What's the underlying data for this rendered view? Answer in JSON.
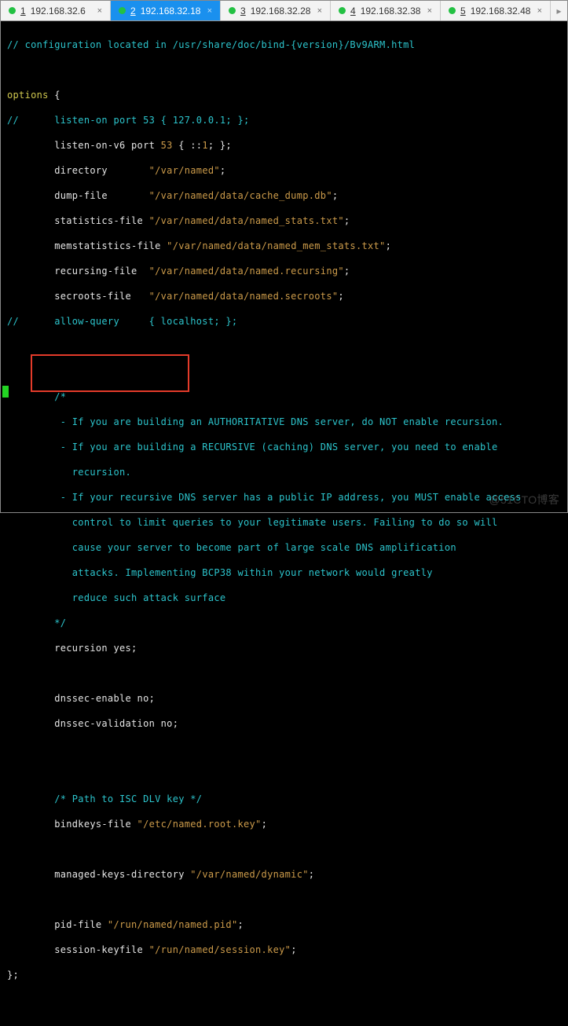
{
  "tabs": [
    {
      "index": "1",
      "label": "192.168.32.6",
      "active": false
    },
    {
      "index": "2",
      "label": "192.168.32.18",
      "active": true
    },
    {
      "index": "3",
      "label": "192.168.32.28",
      "active": false
    },
    {
      "index": "4",
      "label": "192.168.32.38",
      "active": false
    },
    {
      "index": "5",
      "label": "192.168.32.48",
      "active": false
    }
  ],
  "code": {
    "l1_a": "// configuration located in /usr/share/doc/bind-{version}/Bv9ARM.html",
    "l2_a": "options ",
    "l2_b": "{",
    "l3_a": "//      listen-on port 53 { 127.0.0.1; };",
    "l4_a": "        listen-on-v6 port ",
    "l4_b": "53",
    "l4_c": " { ::",
    "l4_d": "1",
    "l4_e": "; };",
    "l5_a": "        directory       ",
    "l5_b": "\"/var/named\"",
    "l5_c": ";",
    "l6_a": "        dump-file       ",
    "l6_b": "\"/var/named/data/cache_dump.db\"",
    "l6_c": ";",
    "l7_a": "        statistics-file ",
    "l7_b": "\"/var/named/data/named_stats.txt\"",
    "l7_c": ";",
    "l8_a": "        memstatistics-file ",
    "l8_b": "\"/var/named/data/named_mem_stats.txt\"",
    "l8_c": ";",
    "l9_a": "        recursing-file  ",
    "l9_b": "\"/var/named/data/named.recursing\"",
    "l9_c": ";",
    "l10_a": "        secroots-file   ",
    "l10_b": "\"/var/named/data/named.secroots\"",
    "l10_c": ";",
    "l11_a": "//      allow-query     { localhost; };",
    "l12_a": "        /*",
    "l13_a": "         - If you are building an AUTHORITATIVE DNS server, do NOT enable recursion.",
    "l14_a": "         - If you are building a RECURSIVE (caching) DNS server, you need to enable",
    "l14_b": "           recursion.",
    "l15_a": "         - If your recursive DNS server has a public IP address, you MUST enable access",
    "l15_b": "           control to limit queries to your legitimate users. Failing to do so will",
    "l15_c": "           cause your server to become part of large scale DNS amplification",
    "l15_d": "           attacks. Implementing BCP38 within your network would greatly",
    "l15_e": "           reduce such attack surface",
    "l16_a": "        */",
    "l17_a": "        recursion yes;",
    "l18_a": "        dnssec-enable no;",
    "l19_a": "        dnssec-validation no;",
    "l20_a": "        /* Path to ISC DLV key */",
    "l21_a": "        bindkeys-file ",
    "l21_b": "\"/etc/named.root.key\"",
    "l21_c": ";",
    "l22_a": "        managed-keys-directory ",
    "l22_b": "\"/var/named/dynamic\"",
    "l22_c": ";",
    "l23_a": "        pid-file ",
    "l23_b": "\"/run/named/named.pid\"",
    "l23_c": ";",
    "l24_a": "        session-keyfile ",
    "l24_b": "\"/run/named/session.key\"",
    "l24_c": ";",
    "l25_a": "};"
  },
  "watermark": "@51CTO博客",
  "close_glyph": "×",
  "arrow_glyph": "▸"
}
